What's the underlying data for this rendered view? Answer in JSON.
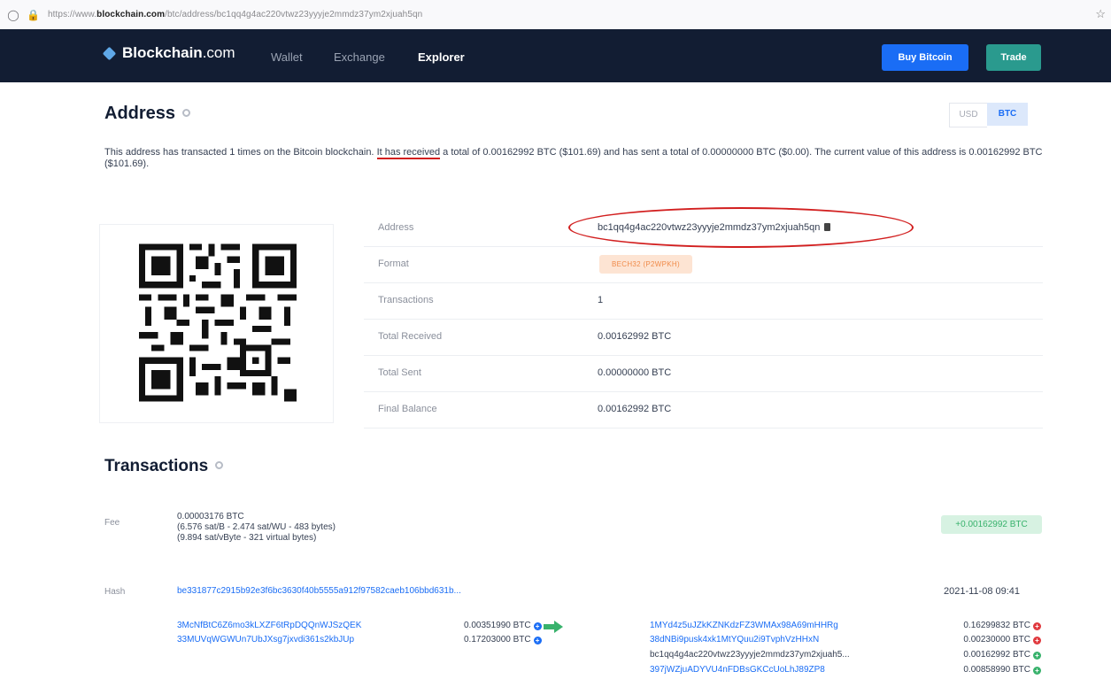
{
  "browser": {
    "url_prefix": "https://www.",
    "url_domain": "blockchain.com",
    "url_path": "/btc/address/bc1qq4g4ac220vtwz23yyyje2mmdz37ym2xjuah5qn"
  },
  "nav": {
    "brand_bold": "Blockchain",
    "brand_suffix": ".com",
    "links": [
      "Wallet",
      "Exchange",
      "Explorer"
    ],
    "buy_label": "Buy Bitcoin",
    "trade_label": "Trade"
  },
  "page": {
    "title": "Address",
    "currency_usd": "USD",
    "currency_btc": "BTC",
    "summary_part1": "This address has transacted 1 times on the Bitcoin blockchain. ",
    "summary_underlined": "It has received",
    "summary_part2": " a total of 0.00162992 BTC ($101.69) and has sent a total of 0.00000000 BTC ($0.00). The current value of this address is 0.00162992 BTC ($101.69)."
  },
  "details": [
    {
      "label": "Address",
      "value": "bc1qq4g4ac220vtwz23yyyje2mmdz37ym2xjuah5qn"
    },
    {
      "label": "Format",
      "value": "BECH32 (P2WPKH)"
    },
    {
      "label": "Transactions",
      "value": "1"
    },
    {
      "label": "Total Received",
      "value": "0.00162992 BTC"
    },
    {
      "label": "Total Sent",
      "value": "0.00000000 BTC"
    },
    {
      "label": "Final Balance",
      "value": "0.00162992 BTC"
    }
  ],
  "transactions": {
    "title": "Transactions",
    "fee_label": "Fee",
    "fee_line1": "0.00003176 BTC",
    "fee_line2": "(6.576 sat/B - 2.474 sat/WU - 483 bytes)",
    "fee_line3": "(9.894 sat/vByte - 321 virtual bytes)",
    "amount": "+0.00162992 BTC",
    "hash_label": "Hash",
    "hash": "be331877c2915b92e3f6bc3630f40b5555a912f97582caeb106bbd631b...",
    "date": "2021-11-08 09:41",
    "inputs": [
      {
        "address": "3McNfBtC6Z6mo3kLXZF6tRpDQQnWJSzQEK",
        "amount": "0.00351990 BTC"
      },
      {
        "address": "33MUVqWGWUn7UbJXsg7jxvdi361s2kbJUp",
        "amount": "0.17203000 BTC"
      }
    ],
    "outputs": [
      {
        "address": "1MYd4z5uJZkKZNKdzFZ3WMAx98A69mHHRg",
        "amount": "0.16299832 BTC"
      },
      {
        "address": "38dNBi9pusk4xk1MtYQuu2i9TvphVzHHxN",
        "amount": "0.00230000 BTC"
      },
      {
        "address": "bc1qq4g4ac220vtwz23yyyje2mmdz37ym2xjuah5...",
        "amount": "0.00162992 BTC"
      },
      {
        "address": "397jWZjuADYVU4nFDBsGKCcUoLhJ89ZP8",
        "amount": "0.00858990 BTC"
      }
    ]
  },
  "colors": {
    "nav_bg": "#121d33",
    "primary": "#1a6df5",
    "trade": "#2a9a8e",
    "annotation": "#d21f1f"
  }
}
